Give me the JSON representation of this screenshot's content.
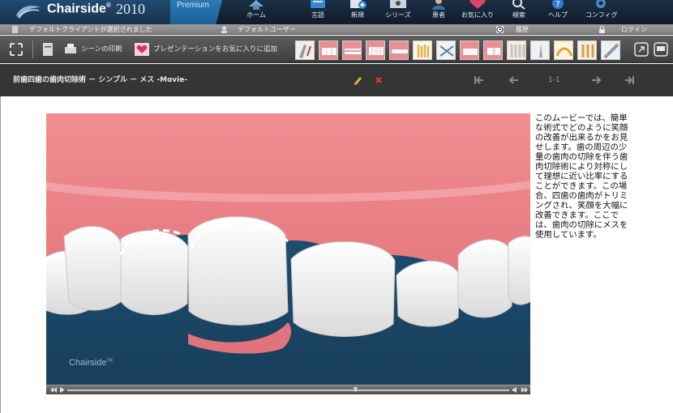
{
  "app": {
    "brand": "Chairside",
    "year": "2010",
    "edition": "Premium"
  },
  "nav": [
    {
      "label": "ホーム",
      "icon": "home-icon"
    },
    {
      "label": "言語",
      "icon": "language-icon"
    },
    {
      "label": "新規",
      "icon": "new-icon"
    },
    {
      "label": "シリーズ",
      "icon": "series-icon"
    },
    {
      "label": "患者",
      "icon": "patient-icon"
    },
    {
      "label": "お気に入り",
      "icon": "favorites-icon"
    },
    {
      "label": "検索",
      "icon": "search-icon"
    },
    {
      "label": "ヘルプ",
      "icon": "help-icon"
    },
    {
      "label": "コンフィグ",
      "icon": "config-icon"
    }
  ],
  "status": {
    "client": "デフォルトクライアントが選択されました",
    "user": "デフォルトユーザー",
    "history": "履歴",
    "login": "ログイン"
  },
  "toolbar": {
    "print_scene": "シーンの印刷",
    "add_favorite": "プレゼンテーションをお気に入りに追加"
  },
  "scene": {
    "title": "前歯四歯の歯肉切除術 － シンプル － メス -Movie-",
    "pager": "1-1"
  },
  "video": {
    "watermark": "Chairside"
  },
  "description": "このムービーでは、簡単な術式でどのように笑顔の改善が出来るかをお見せします。歯の周辺の少量の歯肉の切除を伴う歯肉切除術により対称にして理想に近い比率にすることができます。この場合、四歯の歯肉がトリミングされ、笑顔を大幅に改善できます。ここでは、歯肉の切除にメスを使用しています。",
  "colors": {
    "header": "#13263a",
    "toolbar": "#4d4d4d",
    "titlebar": "#353535",
    "gum": "#e3868a",
    "video_bg": "#1d4a6a"
  }
}
